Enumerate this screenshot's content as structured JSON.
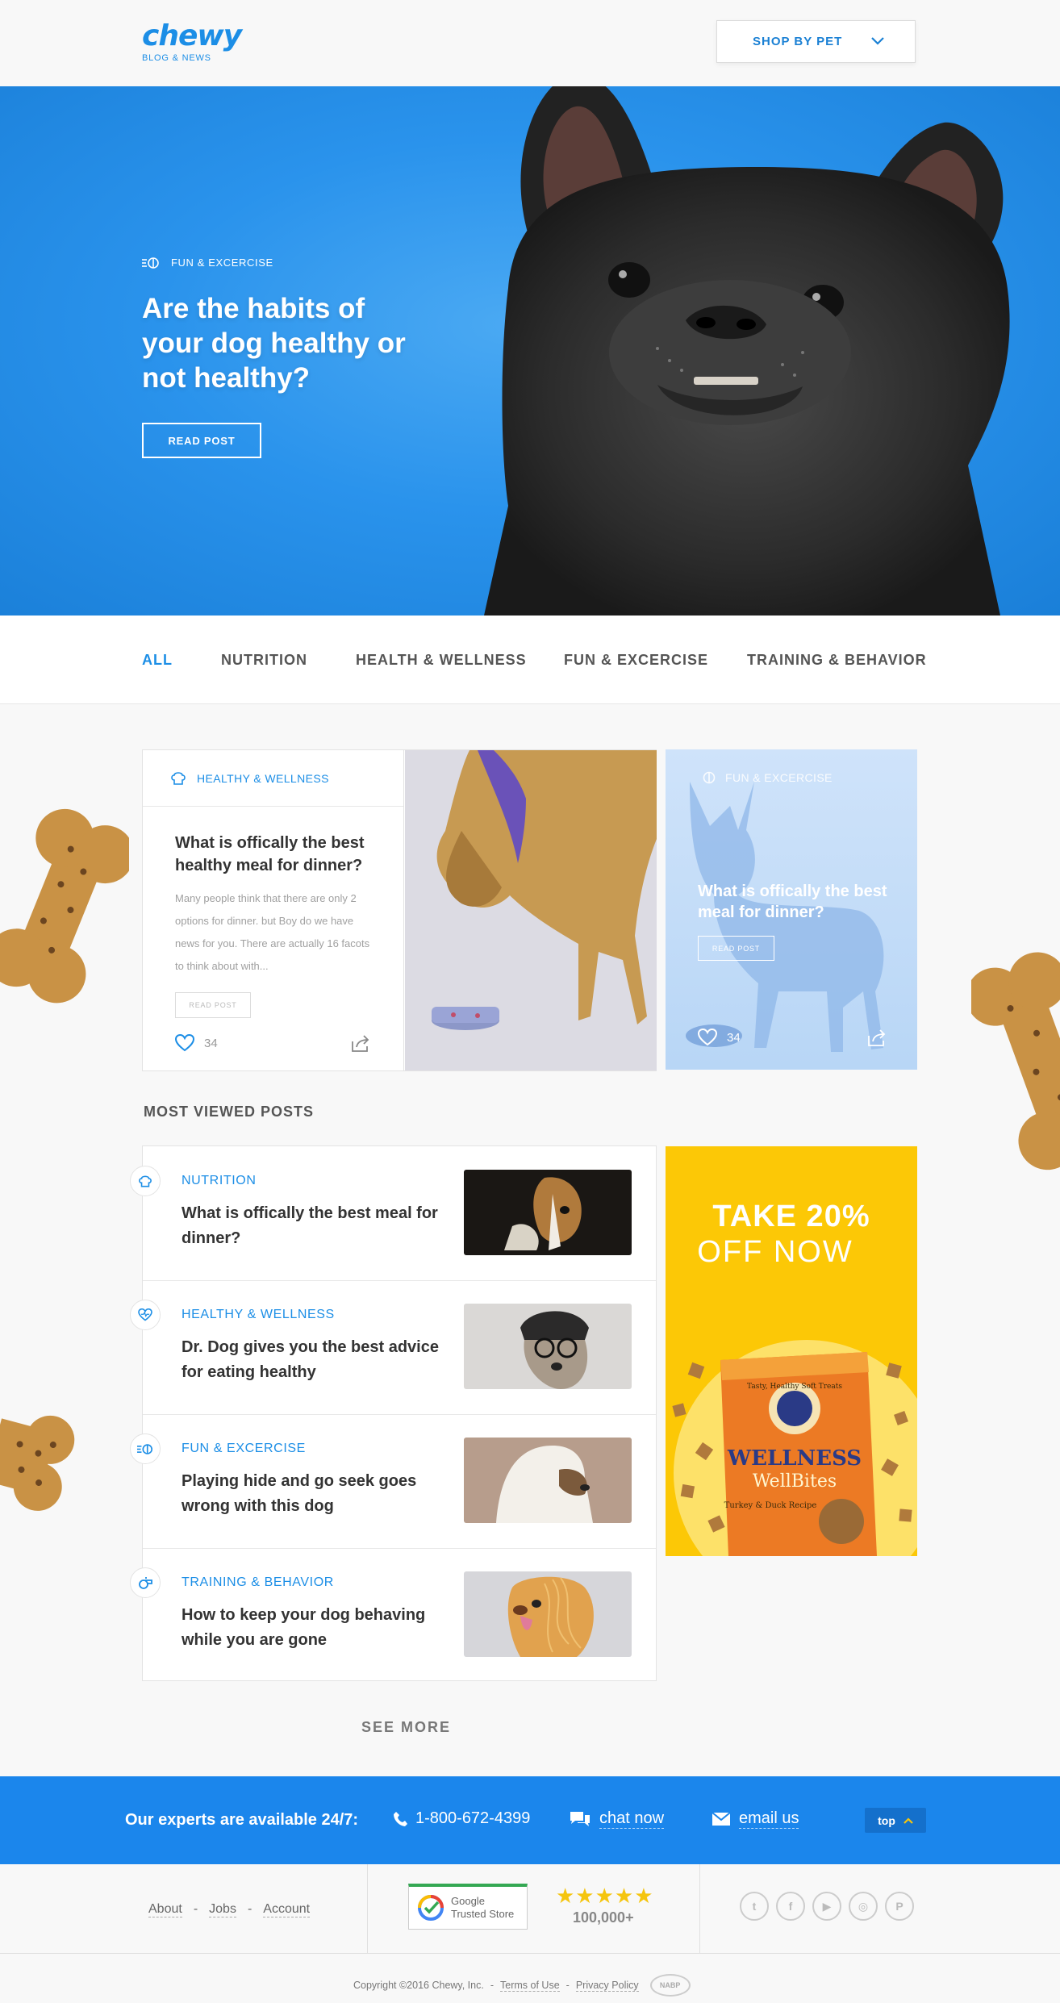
{
  "header": {
    "logo": "chewy",
    "logo_sub": "BLOG & NEWS",
    "shop_label": "SHOP BY PET"
  },
  "hero": {
    "category": "FUN & EXCERCISE",
    "title": "Are the habits of your dog healthy or not healthy?",
    "button": "READ POST"
  },
  "nav": {
    "items": [
      "ALL",
      "NUTRITION",
      "HEALTH & WELLNESS",
      "FUN & EXCERCISE",
      "TRAINING & BEHAVIOR"
    ],
    "active": "ALL"
  },
  "featured": {
    "category": "HEALTHY & WELLNESS",
    "title": "What is offically the best healthy meal for dinner?",
    "excerpt": "Many people think that there are only 2 options for dinner. but Boy do we have news for you. There are actually 16 facots to think about with...",
    "button": "READ POST",
    "likes": "34"
  },
  "side_card": {
    "category": "FUN & EXCERCISE",
    "title": "What is offically the best meal for dinner?",
    "button": "READ POST",
    "likes": "34"
  },
  "most_viewed": {
    "heading": "MOST VIEWED POSTS",
    "items": [
      {
        "category": "NUTRITION",
        "title": "What is offically the best meal for dinner?",
        "icon": "chef-hat-icon"
      },
      {
        "category": "HEALTHY & WELLNESS",
        "title": "Dr. Dog gives you the best advice for eating healthy",
        "icon": "heart-pulse-icon"
      },
      {
        "category": "FUN & EXCERCISE",
        "title": "Playing hide and go seek goes wrong with this dog",
        "icon": "ball-icon"
      },
      {
        "category": "TRAINING & BEHAVIOR",
        "title": "How to keep your dog behaving while you are gone",
        "icon": "whistle-icon"
      }
    ],
    "see_more": "SEE MORE"
  },
  "promo": {
    "line1": "TAKE 20%",
    "line2": "OFF NOW",
    "brand": "WELLNESS",
    "product": "WellBites",
    "flavor": "Turkey & Duck Recipe",
    "tagline": "Tasty, Healthy Soft Treats"
  },
  "expert_bar": {
    "label": "Our experts are available 24/7:",
    "phone": "1-800-672-4399",
    "chat": "chat now",
    "email": "email us",
    "top": "top"
  },
  "footer": {
    "links": [
      "About",
      "Jobs",
      "Account"
    ],
    "badge_line1": "Google",
    "badge_line2": "Trusted Store",
    "stars": "★★★★★",
    "rating_count": "100,000+",
    "copyright": "Copyright ©2016 Chewy, Inc.",
    "terms": "Terms of Use",
    "privacy": "Privacy Policy",
    "nabp": "NABP"
  },
  "colors": {
    "brand_blue": "#1c8ee6",
    "hero_blue": "#2a93ec",
    "promo_yellow": "#fcc806",
    "footer_bar": "#1b86ec"
  }
}
